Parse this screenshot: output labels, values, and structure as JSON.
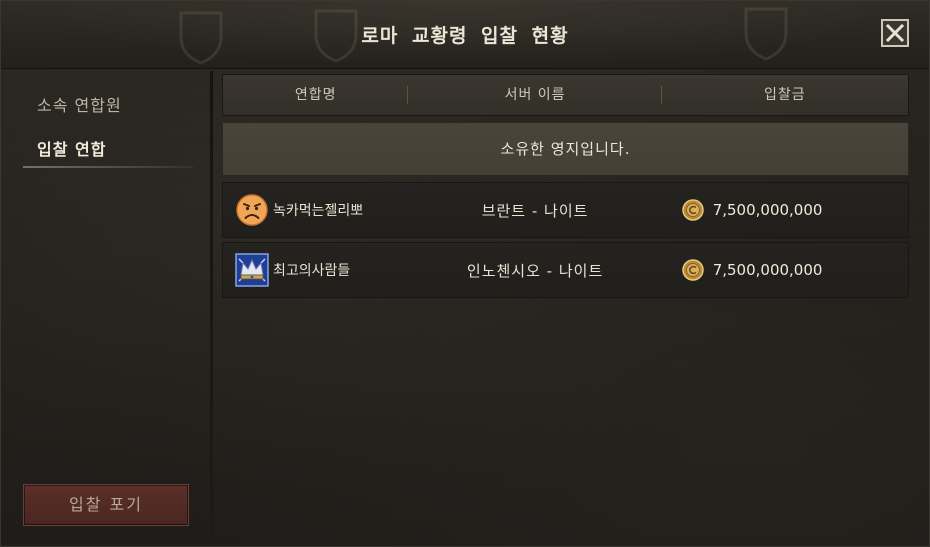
{
  "window": {
    "title": "로마 교황령  입찰 현황"
  },
  "sidebar": {
    "items": [
      {
        "label": "소속 연합원",
        "active": false
      },
      {
        "label": "입찰 연합",
        "active": true
      }
    ],
    "giveup_label": "입찰 포기"
  },
  "table": {
    "headers": [
      "연합명",
      "서버 이름",
      "입찰금"
    ],
    "notice": "소유한 영지입니다.",
    "rows": [
      {
        "alliance": "녹카먹는젤리뽀",
        "server": "브란트 - 나이트",
        "bid": "7,500,000,000",
        "emblem": "sad-face-emblem-icon"
      },
      {
        "alliance": "최고의사람들",
        "server": "인노첸시오 - 나이트",
        "bid": "7,500,000,000",
        "emblem": "crown-emblem-icon"
      }
    ]
  },
  "colors": {
    "accent": "#4a2622",
    "notice_bg": "#4a443b",
    "emblem_orange": "#f0a050",
    "emblem_blue": "#2a4fa8"
  },
  "icons": {
    "close": "close-icon",
    "currency": "gold-coin-icon"
  }
}
